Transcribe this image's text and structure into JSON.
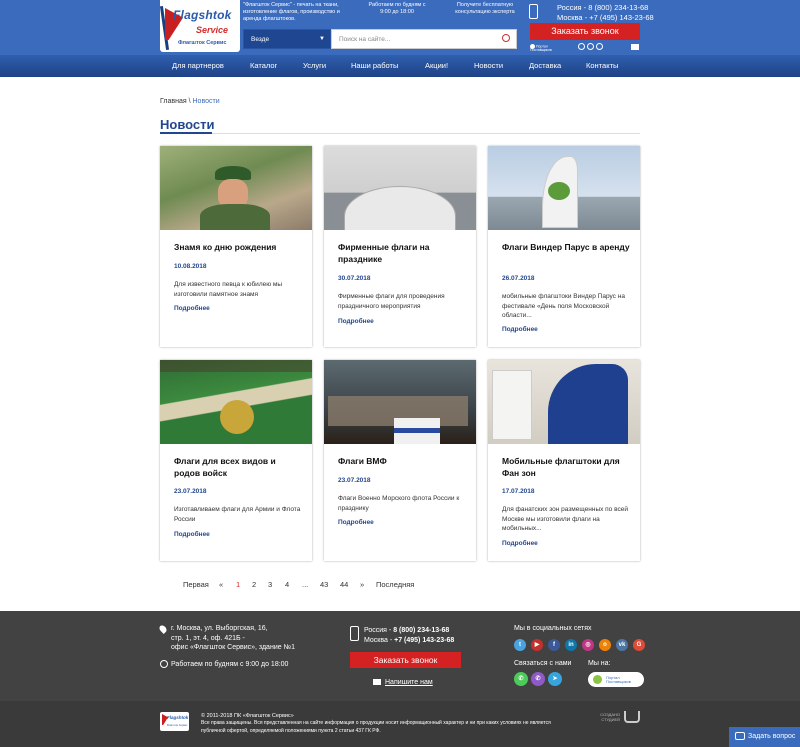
{
  "header": {
    "logo_main": "Flagshtok",
    "logo_sub": "Service",
    "logo_caption": "Флагшток Сервис",
    "tagline": "\"Флагшток Сервис\" - печать на ткани, изготовление флагов, производство и аренда флагштоков.",
    "hours": "Работаем по будням с 9:00 до 18:00",
    "consult": "Получите бесплатную консультацию эксперта",
    "phone_russia": "Россия - 8 (800) 234-13-68",
    "phone_moscow": "Москва - +7 (495) 143-23-68",
    "call_button": "Заказать звонок",
    "portal_label": "Портал Поставщиков",
    "search_scope": "Везде",
    "search_placeholder": "Поиск на сайте..."
  },
  "nav": {
    "items": [
      "Для партнеров",
      "Каталог",
      "Услуги",
      "Наши работы",
      "Акции!",
      "Новости",
      "Доставка",
      "Контакты"
    ]
  },
  "breadcrumb": {
    "home": "Главная",
    "sep": " \\ ",
    "current": "Новости"
  },
  "page_title": "Новости",
  "cards": [
    {
      "title": "Знамя ко дню рождения",
      "date": "10.08.2018",
      "desc": "Для известного певца к юбилею мы изготовили памятное знамя",
      "more": "Подробнее"
    },
    {
      "title": "Фирменные флаги на празднике",
      "date": "30.07.2018",
      "desc": "Фирменные флаги для проведения праздничного мероприятия",
      "more": "Подробнее"
    },
    {
      "title": "Флаги Виндер Парус в аренду",
      "date": "26.07.2018",
      "desc": "мобильные флагштоки Виндер Парус на фестивале «День поля Московской области...",
      "more": "Подробнее"
    },
    {
      "title": "Флаги для всех видов и родов войск",
      "date": "23.07.2018",
      "desc": "Изготавливаем флаги для Армии и Флота России",
      "more": "Подробнее"
    },
    {
      "title": "Флаги ВМФ",
      "date": "23.07.2018",
      "desc": "Флаги Военно Морского флота России к празднику",
      "more": "Подробнее"
    },
    {
      "title": "Мобильные флагштоки для Фан зон",
      "date": "17.07.2018",
      "desc": "Для фанатских зон размещенных по всей Москве мы изготовили флаги на мобильных...",
      "more": "Подробнее"
    }
  ],
  "pager": {
    "first": "Первая",
    "prev": "«",
    "pages": [
      "1",
      "2",
      "3",
      "4",
      "...",
      "43",
      "44"
    ],
    "next": "»",
    "last": "Последняя",
    "active": "1"
  },
  "footer": {
    "address1": "г. Москва, ул. Выборгская, 16,",
    "address2": "стр. 1, эт. 4, оф. 421Б -",
    "address3": "офис «Флагшток Сервис», здание №1",
    "hours": "Работаем по будням с 9:00 до 18:00",
    "phone_russia_label": "Россия - ",
    "phone_russia": "8 (800) 234-13-68",
    "phone_moscow_label": "Москва - ",
    "phone_moscow": "+7 (495) 143-23-68",
    "call_button": "Заказать звонок",
    "write_us": "Напишите нам",
    "social_title": "Мы в социальных сетях",
    "contact_title": "Связаться с нами",
    "we_on": "Мы на:",
    "portal_label": "Портал Поставщиков",
    "copyright": "© 2011-2018 ПК «Флагшток Сервис»",
    "rights": "Все права защищены. Вся представленная на сайте информация о продукции носит информационный характер и ни при каких условиях не является публичной офертой, определяемой положениями пункта 2 статьи 437 ГК РФ.",
    "studio": "СОЗДАНО СТУДИЕЙ",
    "logo_main": "Flagshtok",
    "logo_caption": "Флагшток Сервис"
  },
  "ask_button": "Задать вопрос",
  "colors": {
    "brand_blue": "#3b6bbd",
    "nav_dark": "#1e4286",
    "accent_red": "#d42222",
    "footer": "#424242"
  }
}
